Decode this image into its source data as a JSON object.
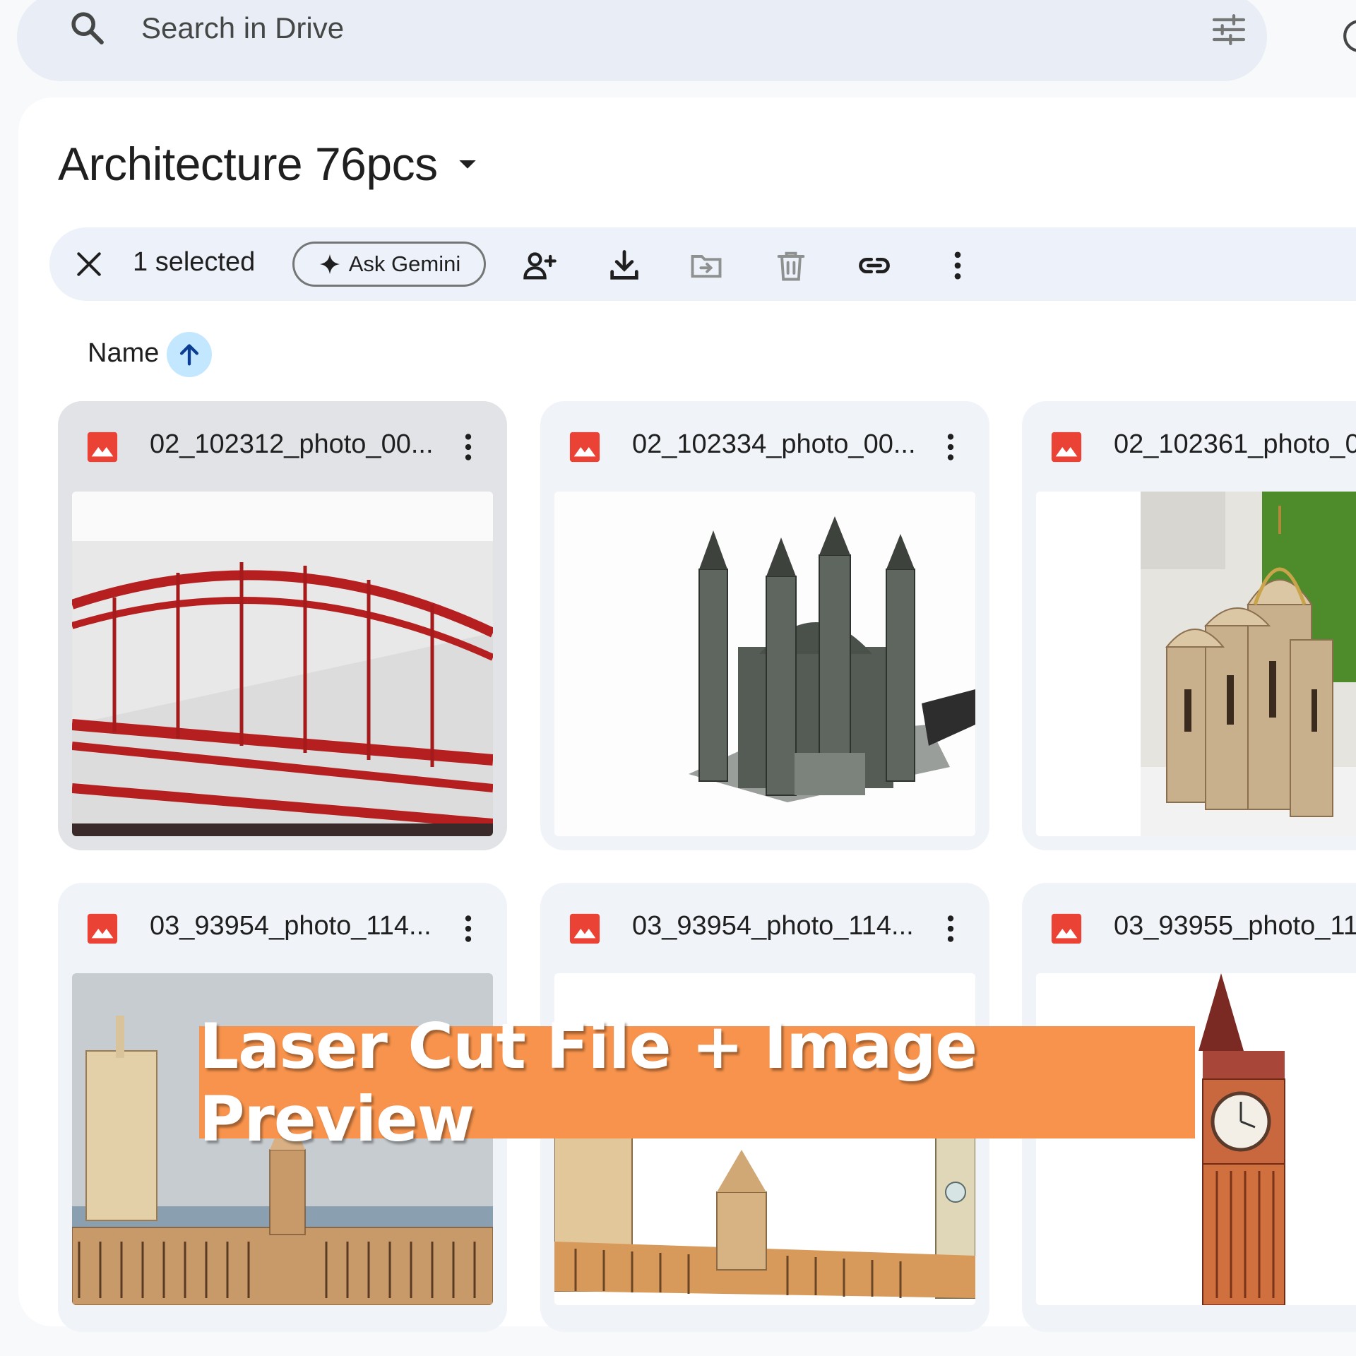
{
  "search": {
    "placeholder": "Search in Drive"
  },
  "folder": {
    "title": "Architecture 76pcs"
  },
  "selection_bar": {
    "count_label": "1 selected",
    "gemini_label": "Ask Gemini"
  },
  "sort": {
    "label": "Name",
    "direction": "ascending"
  },
  "files": [
    {
      "name": "02_102312_photo_00...",
      "selected": true
    },
    {
      "name": "02_102334_photo_00...",
      "selected": false
    },
    {
      "name": "02_102361_photo_0",
      "selected": false
    },
    {
      "name": "03_93954_photo_114...",
      "selected": false
    },
    {
      "name": "03_93954_photo_114...",
      "selected": false
    },
    {
      "name": "03_93955_photo_11",
      "selected": false
    }
  ],
  "banner": {
    "text": "Laser Cut File + Image Preview"
  },
  "colors": {
    "accent_blue": "#c2e7ff",
    "sort_arrow": "#0b57d0",
    "image_icon_red": "#ea4335",
    "banner_orange": "#f7934c"
  },
  "icons": [
    "search-icon",
    "filter-icon",
    "help-icon",
    "close-icon",
    "sparkle-icon",
    "share-icon",
    "download-icon",
    "move-icon",
    "trash-icon",
    "link-icon",
    "more-vert-icon",
    "arrow-up-icon",
    "image-icon"
  ]
}
